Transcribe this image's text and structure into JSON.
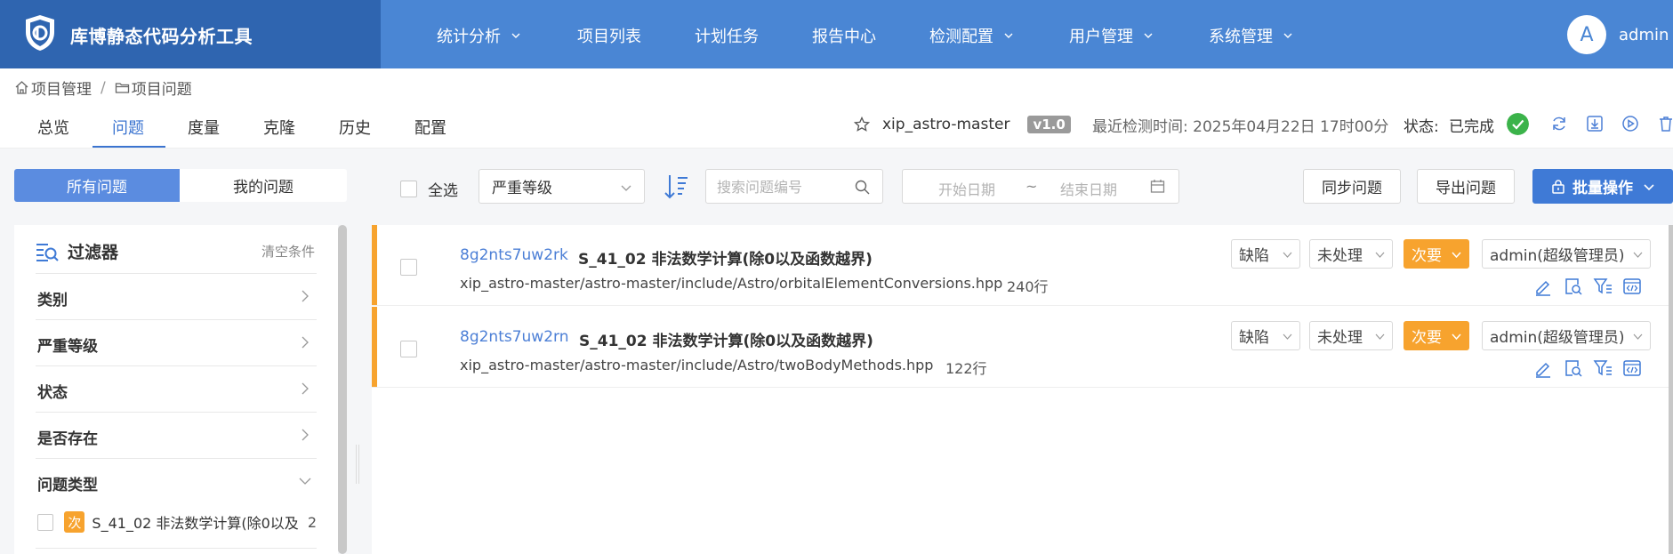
{
  "app": {
    "title": "库博静态代码分析工具",
    "brand_color": "#2f65b0",
    "header_color": "#4a86d4"
  },
  "nav": [
    {
      "label": "统计分析",
      "dropdown": true
    },
    {
      "label": "项目列表",
      "dropdown": false
    },
    {
      "label": "计划任务",
      "dropdown": false
    },
    {
      "label": "报告中心",
      "dropdown": false
    },
    {
      "label": "检测配置",
      "dropdown": true
    },
    {
      "label": "用户管理",
      "dropdown": true
    },
    {
      "label": "系统管理",
      "dropdown": true
    }
  ],
  "user": {
    "avatar": "A",
    "name": "admin"
  },
  "breadcrumb": {
    "home": "项目管理",
    "sep": "/",
    "current": "项目问题"
  },
  "tabs": [
    "总览",
    "问题",
    "度量",
    "克隆",
    "历史",
    "配置"
  ],
  "active_tab": "问题",
  "project": {
    "name": "xip_astro-master",
    "version": "v1.0",
    "last_check": "最近检测时间: 2025年04月22日 17时00分",
    "status_label": "状态:",
    "status_value": "已完成",
    "status_color": "#3bb34a"
  },
  "header_actions": [
    "refresh-icon",
    "download-icon",
    "play-icon",
    "delete-icon"
  ],
  "toolbar": {
    "all_issues": "所有问题",
    "my_issues": "我的问题",
    "select_all": "全选",
    "severity_placeholder": "严重等级",
    "search_placeholder": "搜索问题编号",
    "start_date": "开始日期",
    "date_sep": "~",
    "end_date": "结束日期",
    "sync": "同步问题",
    "export": "导出问题",
    "batch": "批量操作"
  },
  "filter": {
    "title": "过滤器",
    "clear": "清空条件",
    "rows": [
      "类别",
      "严重等级",
      "状态",
      "是否存在",
      "问题类型"
    ],
    "item": {
      "tag": "次",
      "label": "S_41_02 非法数学计算(除0以及",
      "count": "2"
    }
  },
  "issues": [
    {
      "id": "8g2nts7uw2rk",
      "title": "S_41_02 非法数学计算(除0以及函数越界)",
      "path": "xip_astro-master/astro-master/include/Astro/orbitalElementConversions.hpp",
      "line": "240行",
      "category": "缺陷",
      "status": "未处理",
      "severity": "次要",
      "assignee": "admin(超级管理员)"
    },
    {
      "id": "8g2nts7uw2rn",
      "title": "S_41_02 非法数学计算(除0以及函数越界)",
      "path": "xip_astro-master/astro-master/include/Astro/twoBodyMethods.hpp",
      "line": "122行",
      "category": "缺陷",
      "status": "未处理",
      "severity": "次要",
      "assignee": "admin(超级管理员)"
    }
  ],
  "issue_actions": [
    "edit-icon",
    "inspect-icon",
    "filter-icon",
    "code-icon"
  ],
  "colors": {
    "accent": "#3f7ad6",
    "minor": "#f7a32e",
    "link": "#4c7fd6"
  }
}
